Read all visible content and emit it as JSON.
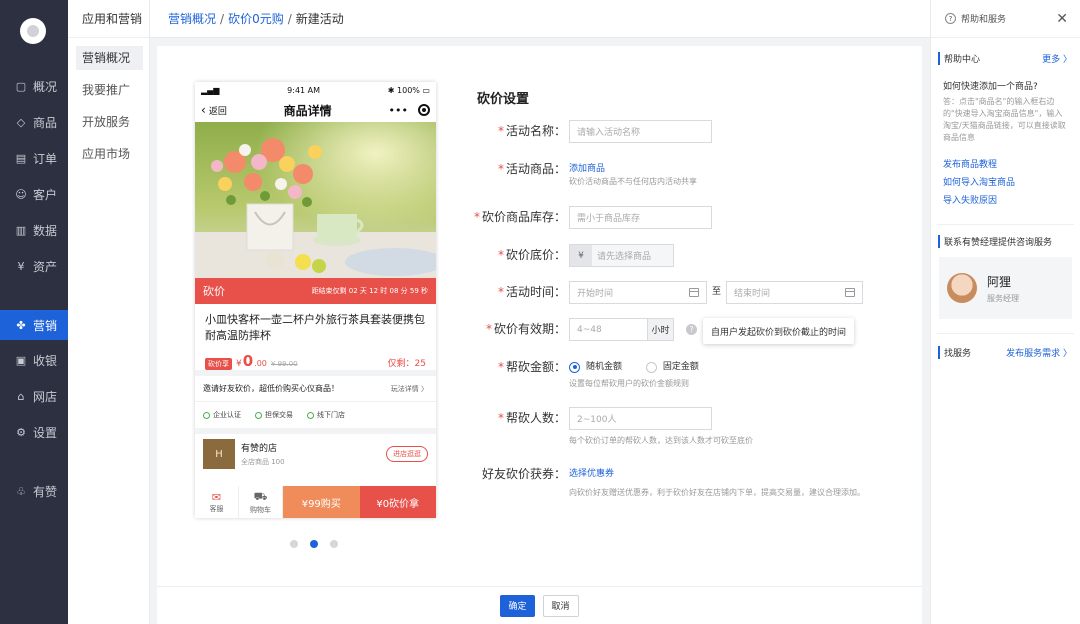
{
  "rail": {
    "items": [
      {
        "label": "概况",
        "icon": "overview-icon",
        "glyph": "▢"
      },
      {
        "label": "商品",
        "icon": "tag-icon",
        "glyph": "◇"
      },
      {
        "label": "订单",
        "icon": "order-icon",
        "glyph": "▤"
      },
      {
        "label": "客户",
        "icon": "customer-icon",
        "glyph": "☺"
      },
      {
        "label": "数据",
        "icon": "chart-icon",
        "glyph": "▥"
      },
      {
        "label": "资产",
        "icon": "asset-icon",
        "glyph": "¥"
      },
      {
        "label": "营销",
        "icon": "marketing-icon",
        "glyph": "✤"
      },
      {
        "label": "收银",
        "icon": "cashier-icon",
        "glyph": "▣"
      },
      {
        "label": "网店",
        "icon": "shop-icon",
        "glyph": "⌂"
      },
      {
        "label": "设置",
        "icon": "gear-icon",
        "glyph": "⚙"
      },
      {
        "label": "有赞",
        "icon": "thumb-icon",
        "glyph": "♧"
      }
    ]
  },
  "sidebar": {
    "heading": "应用和营销",
    "items": [
      {
        "label": "营销概况"
      },
      {
        "label": "我要推广"
      },
      {
        "label": "开放服务"
      },
      {
        "label": "应用市场"
      }
    ]
  },
  "breadcrumb": {
    "items": [
      "营销概况",
      "砍价0元购",
      "新建活动"
    ],
    "sep": "/"
  },
  "phone": {
    "status_time": "9:41 AM",
    "status_battery": "100%",
    "back_label": "返回",
    "title": "商品详情",
    "more": "•••",
    "bar_label": "砍价",
    "countdown": "距结束仅剩  02 天 12 时 08 分 59 秒",
    "product_name": "小皿快客杯一壶二杯户外旅行茶具套装便携包耐高温防摔杯",
    "price_tag": "砍价享",
    "price_currency": "¥",
    "price_int": "0",
    "price_dec": ".00",
    "price_orig": "¥ 99.00",
    "remaining": "仅剩：25",
    "invite_text": "邀请好友砍价，超低价购买心仪商品！",
    "rule_link": "玩法详情 〉",
    "guarantees": [
      "企业认证",
      "担保交易",
      "线下门店"
    ],
    "shop_logo": "H",
    "shop_name": "有赞的店",
    "shop_count": "全店商品 100",
    "visit_shop": "进店逛逛",
    "foot_service": "客服",
    "foot_cart": "购物车",
    "buy_label": "¥99购买",
    "cut_label": "¥0砍价拿"
  },
  "form": {
    "title": "砍价设置",
    "name_label": "活动名称：",
    "name_placeholder": "请输入活动名称",
    "goods_label": "活动商品：",
    "goods_link": "添加商品",
    "goods_hint": "砍价活动商品不与任何店内活动共享",
    "stock_label": "砍价商品库存：",
    "stock_placeholder": "需小于商品库存",
    "floor_label": "砍价底价：",
    "floor_prefix": "¥",
    "floor_placeholder": "请先选择商品",
    "time_label": "活动时间：",
    "time_start": "开始时间",
    "time_to": "至",
    "time_end": "结束时间",
    "valid_label": "砍价有效期：",
    "valid_placeholder": "4~48",
    "valid_unit": "小时",
    "valid_tip": "自用户发起砍价到砍价截止的时间",
    "amount_label": "帮砍金额：",
    "amount_random": "随机金额",
    "amount_fixed": "固定金额",
    "amount_hint": "设置每位帮砍用户的砍价金额规则",
    "people_label": "帮砍人数：",
    "people_placeholder": "2~100人",
    "people_hint": "每个砍价订单的帮砍人数，达到该人数才可砍至底价",
    "coupon_label": "好友砍价获券：",
    "coupon_link": "选择优惠券",
    "coupon_hint": "向砍价好友赠送优惠券，利于砍价好友在店铺内下单，提高交易量，建议合理添加。"
  },
  "actions": {
    "confirm": "确定",
    "cancel": "取消"
  },
  "help": {
    "title": "帮助和服务",
    "center": "帮助中心",
    "more": "更多 〉",
    "question": "如何快速添加一个商品?",
    "answer": "答：点击\"商品名\"的输入框右边的\"快速导入淘宝商品信息\"，输入淘宝/天猫商品链接，可以直接读取商品信息",
    "links": [
      "发布商品教程",
      "如何导入淘宝商品",
      "导入失败原因"
    ],
    "contact_title": "联系有赞经理提供咨询服务",
    "manager_name": "阿狸",
    "manager_role": "服务经理",
    "find_service": "找服务",
    "publish_demand": "发布服务需求 〉"
  },
  "colors": {
    "accent": "#1e62d9",
    "red": "#e8504a",
    "orange": "#f08b5a",
    "rail_bg": "#2c3040"
  }
}
